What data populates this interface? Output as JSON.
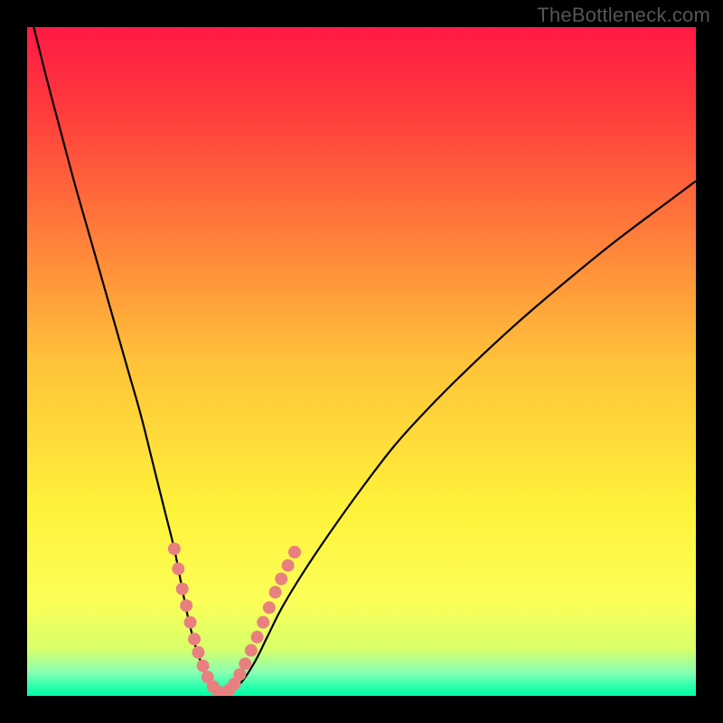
{
  "watermark": "TheBottleneck.com",
  "chart_data": {
    "type": "line",
    "title": "",
    "xlabel": "",
    "ylabel": "",
    "xlim": [
      0,
      100
    ],
    "ylim": [
      0,
      100
    ],
    "gradient_stops": [
      {
        "offset": 0.0,
        "color": "#ff1a44"
      },
      {
        "offset": 0.12,
        "color": "#ff3a3d"
      },
      {
        "offset": 0.3,
        "color": "#ff7a3a"
      },
      {
        "offset": 0.5,
        "color": "#ffc23a"
      },
      {
        "offset": 0.72,
        "color": "#fff23a"
      },
      {
        "offset": 0.86,
        "color": "#fbff58"
      },
      {
        "offset": 0.93,
        "color": "#d7ff6a"
      },
      {
        "offset": 0.965,
        "color": "#88ffb3"
      },
      {
        "offset": 0.985,
        "color": "#2dffad"
      },
      {
        "offset": 1.0,
        "color": "#00ffa2"
      }
    ],
    "series": [
      {
        "name": "bottleneck-curve",
        "x": [
          1,
          3,
          5,
          7,
          9,
          11,
          13,
          15,
          17,
          19,
          20.5,
          22,
          23,
          24,
          25,
          26,
          27,
          28,
          29,
          30,
          32,
          34,
          36,
          38,
          41,
          45,
          50,
          55,
          60,
          66,
          73,
          80,
          88,
          96,
          100
        ],
        "values": [
          100,
          92,
          84.5,
          77,
          70,
          63,
          56,
          49,
          42,
          34,
          28,
          22,
          17,
          12,
          8,
          5,
          2.5,
          1,
          0.3,
          0.5,
          2,
          5,
          9,
          13,
          18,
          24,
          31,
          37.5,
          43,
          49,
          55.5,
          61.5,
          68,
          74,
          77
        ]
      }
    ],
    "markers": {
      "name": "curve-markers",
      "points": [
        {
          "x": 22.0,
          "y": 22.0
        },
        {
          "x": 22.6,
          "y": 19.0
        },
        {
          "x": 23.2,
          "y": 16.0
        },
        {
          "x": 23.8,
          "y": 13.5
        },
        {
          "x": 24.4,
          "y": 11.0
        },
        {
          "x": 25.0,
          "y": 8.5
        },
        {
          "x": 25.6,
          "y": 6.5
        },
        {
          "x": 26.3,
          "y": 4.5
        },
        {
          "x": 27.0,
          "y": 2.8
        },
        {
          "x": 27.8,
          "y": 1.4
        },
        {
          "x": 28.6,
          "y": 0.6
        },
        {
          "x": 29.4,
          "y": 0.4
        },
        {
          "x": 30.2,
          "y": 0.9
        },
        {
          "x": 31.0,
          "y": 1.8
        },
        {
          "x": 31.8,
          "y": 3.2
        },
        {
          "x": 32.6,
          "y": 4.8
        },
        {
          "x": 33.5,
          "y": 6.8
        },
        {
          "x": 34.4,
          "y": 8.8
        },
        {
          "x": 35.3,
          "y": 11.0
        },
        {
          "x": 36.2,
          "y": 13.2
        },
        {
          "x": 37.1,
          "y": 15.5
        },
        {
          "x": 38.0,
          "y": 17.5
        },
        {
          "x": 39.0,
          "y": 19.5
        },
        {
          "x": 40.0,
          "y": 21.5
        }
      ]
    }
  }
}
